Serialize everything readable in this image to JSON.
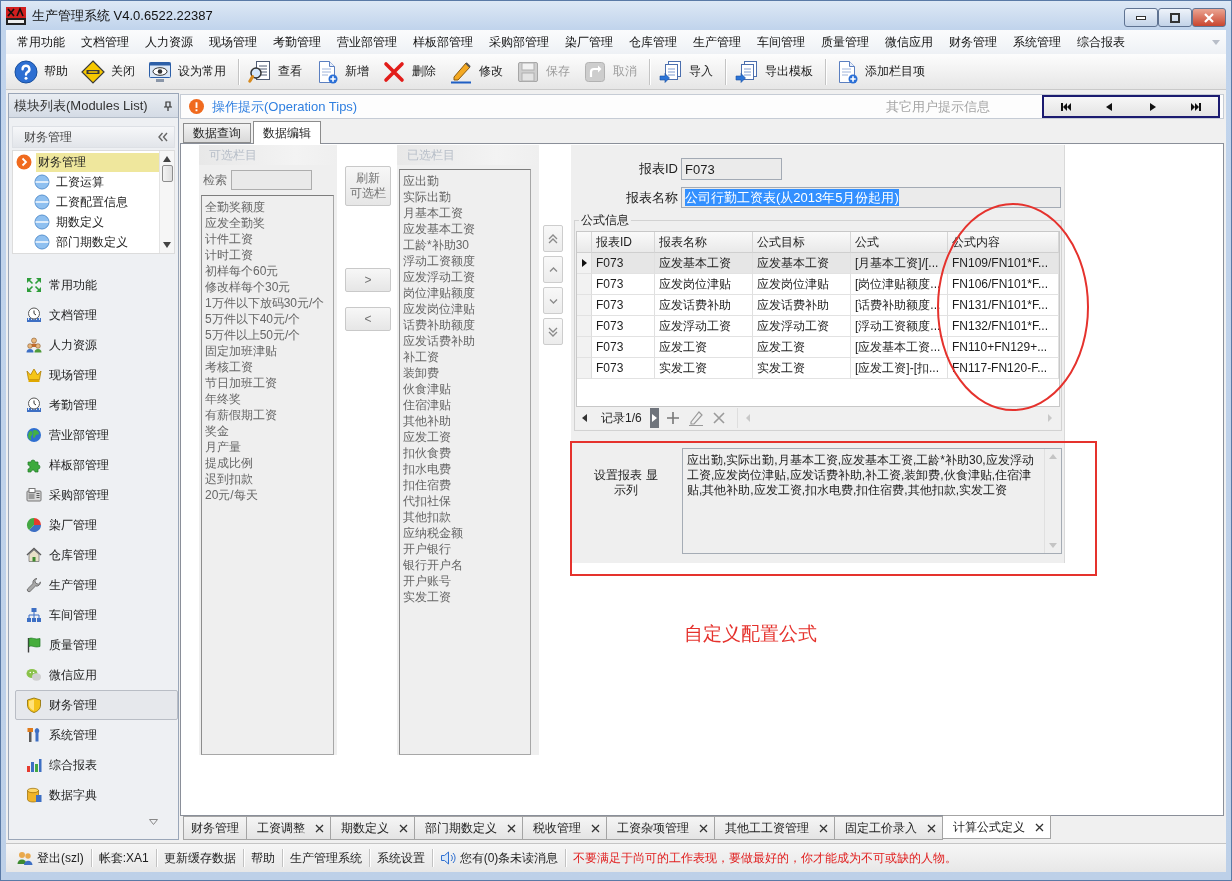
{
  "window": {
    "title": "生产管理系统 V4.0.6522.22387"
  },
  "menu": [
    "常用功能",
    "文档管理",
    "人力资源",
    "现场管理",
    "考勤管理",
    "营业部管理",
    "样板部管理",
    "采购部管理",
    "染厂管理",
    "仓库管理",
    "生产管理",
    "车间管理",
    "质量管理",
    "微信应用",
    "财务管理",
    "系统管理",
    "综合报表"
  ],
  "toolbar": [
    [
      {
        "label": "帮助",
        "kind": "help",
        "disabled": false
      },
      {
        "label": "关闭",
        "kind": "exit",
        "disabled": false
      },
      {
        "label": "设为常用",
        "kind": "favorite",
        "disabled": false
      }
    ],
    [
      {
        "label": "查看",
        "kind": "view",
        "disabled": false
      },
      {
        "label": "新增",
        "kind": "new",
        "disabled": false
      },
      {
        "label": "删除",
        "kind": "delete",
        "disabled": false
      },
      {
        "label": "修改",
        "kind": "edit",
        "disabled": false
      },
      {
        "label": "保存",
        "kind": "save",
        "disabled": true
      },
      {
        "label": "取消",
        "kind": "cancel",
        "disabled": true
      }
    ],
    [
      {
        "label": "导入",
        "kind": "import",
        "disabled": false
      }
    ],
    [
      {
        "label": "导出模板",
        "kind": "export",
        "disabled": false
      }
    ],
    [
      {
        "label": "添加栏目项",
        "kind": "addcolumn",
        "disabled": false
      }
    ]
  ],
  "modules": {
    "title": "模块列表(Modules List)",
    "group": {
      "title": "财务管理",
      "tree": [
        {
          "label": "财务管理",
          "selected": true,
          "children": [
            {
              "label": "工资运算",
              "selected": false
            },
            {
              "label": "工资配置信息",
              "selected": false
            },
            {
              "label": "期数定义",
              "selected": false
            },
            {
              "label": "部门期数定义",
              "selected": false
            }
          ]
        }
      ]
    },
    "nav": [
      {
        "label": "常用功能",
        "kind": "common",
        "selected": false
      },
      {
        "label": "文档管理",
        "kind": "document",
        "selected": false
      },
      {
        "label": "人力资源",
        "kind": "hr",
        "selected": false
      },
      {
        "label": "现场管理",
        "kind": "site",
        "selected": false
      },
      {
        "label": "考勤管理",
        "kind": "attendance",
        "selected": false
      },
      {
        "label": "营业部管理",
        "kind": "sales",
        "selected": false
      },
      {
        "label": "样板部管理",
        "kind": "sample",
        "selected": false
      },
      {
        "label": "采购部管理",
        "kind": "purchase",
        "selected": false
      },
      {
        "label": "染厂管理",
        "kind": "dye",
        "selected": false
      },
      {
        "label": "仓库管理",
        "kind": "warehouse",
        "selected": false
      },
      {
        "label": "生产管理",
        "kind": "production",
        "selected": false
      },
      {
        "label": "车间管理",
        "kind": "workshop",
        "selected": false
      },
      {
        "label": "质量管理",
        "kind": "quality",
        "selected": false
      },
      {
        "label": "微信应用",
        "kind": "wechat",
        "selected": false
      },
      {
        "label": "财务管理",
        "kind": "finance",
        "selected": true
      },
      {
        "label": "系统管理",
        "kind": "system",
        "selected": false
      },
      {
        "label": "综合报表",
        "kind": "report",
        "selected": false
      },
      {
        "label": "数据字典",
        "kind": "dictionary",
        "selected": false
      }
    ]
  },
  "tips": {
    "title": "操作提示(Operation Tips)",
    "other": "其它用户提示信息",
    "nav": [
      {
        "kind": "first"
      },
      {
        "kind": "prev"
      },
      {
        "kind": "next"
      },
      {
        "kind": "last"
      }
    ]
  },
  "tabs": [
    {
      "label": "数据查询",
      "selected": false
    },
    {
      "label": "数据编辑",
      "selected": true
    }
  ],
  "available_columns": {
    "title": "可选栏目",
    "disabled": true,
    "search_label": "检索",
    "items": [
      "全勤奖额度",
      "应发全勤奖",
      "计件工资",
      "计时工资",
      "初样每个60元",
      "修改样每个30元",
      "1万件以下放码30元/个",
      "5万件以下40元/个",
      "5万件以上50元/个",
      "固定加班津贴",
      "考核工资",
      "节日加班工资",
      "年终奖",
      "有薪假期工资",
      "奖金",
      "月产量",
      "提成比例",
      "迟到扣款",
      "20元/每天"
    ]
  },
  "refresh_button": "刷新可选栏",
  "transfer_buttons": [
    ">",
    "<"
  ],
  "selected_columns": {
    "title": "已选栏目",
    "disabled": true,
    "items": [
      "应出勤",
      "实际出勤",
      "月基本工资",
      "应发基本工资",
      "工龄*补助30",
      "浮动工资额度",
      "应发浮动工资",
      "岗位津贴额度",
      "应发岗位津贴",
      "话费补助额度",
      "应发话费补助",
      "补工资",
      "装卸费",
      "伙食津贴",
      "住宿津贴",
      "其他补助",
      "应发工资",
      "扣伙食费",
      "扣水电费",
      "扣住宿费",
      "代扣社保",
      "其他扣款",
      "应纳税金额",
      "开户银行",
      "银行开户名",
      "开户账号",
      "实发工资"
    ]
  },
  "move_buttons": [
    {
      "kind": "top"
    },
    {
      "kind": "up"
    },
    {
      "kind": "down"
    },
    {
      "kind": "bottom"
    }
  ],
  "report": {
    "id_label": "报表ID",
    "id_value": "F073",
    "name_label": "报表名称",
    "name_value": "公司行勤工资表(从2013年5月份起用)",
    "name_text_selected": true
  },
  "formula_info": {
    "title": "公式信息",
    "columns": [
      "报表ID",
      "报表名称",
      "公式目标",
      "公式",
      "公式内容"
    ],
    "rows": [
      {
        "selected": true,
        "cells": [
          "F073",
          "应发基本工资",
          "应发基本工资",
          "[月基本工资]/[...",
          "FN109/FN101*F..."
        ]
      },
      {
        "selected": false,
        "cells": [
          "F073",
          "应发岗位津贴",
          "应发岗位津贴",
          "[岗位津贴额度...",
          "FN106/FN101*F..."
        ]
      },
      {
        "selected": false,
        "cells": [
          "F073",
          "应发话费补助",
          "应发话费补助",
          "[话费补助额度...",
          "FN131/FN101*F..."
        ]
      },
      {
        "selected": false,
        "cells": [
          "F073",
          "应发浮动工资",
          "应发浮动工资",
          "[浮动工资额度...",
          "FN132/FN101*F..."
        ]
      },
      {
        "selected": false,
        "cells": [
          "F073",
          "应发工资",
          "应发工资",
          "[应发基本工资...",
          "FN110+FN129+..."
        ]
      },
      {
        "selected": false,
        "cells": [
          "F073",
          "实发工资",
          "实发工资",
          "[应发工资]-[扣...",
          "FN117-FN120-F..."
        ]
      }
    ],
    "record": "记录1/6"
  },
  "display_columns": {
    "label": "设置报表 显示列",
    "value": "应出勤,实际出勤,月基本工资,应发基本工资,工龄*补助30,应发浮动工资,应发岗位津贴,应发话费补助,补工资,装卸费,伙食津贴,住宿津贴,其他补助,应发工资,扣水电费,扣住宿费,其他扣款,实发工资"
  },
  "annotation": {
    "caption": "自定义配置公式"
  },
  "doc_tabs": [
    {
      "label": "财务管理",
      "closable": false,
      "selected": false
    },
    {
      "label": "工资调整",
      "closable": true,
      "selected": false
    },
    {
      "label": "期数定义",
      "closable": true,
      "selected": false
    },
    {
      "label": "部门期数定义",
      "closable": true,
      "selected": false
    },
    {
      "label": "税收管理",
      "closable": true,
      "selected": false
    },
    {
      "label": "工资杂项管理",
      "closable": true,
      "selected": false
    },
    {
      "label": "其他工工资管理",
      "closable": true,
      "selected": false
    },
    {
      "label": "固定工价录入",
      "closable": true,
      "selected": false
    },
    {
      "label": "计算公式定义",
      "closable": true,
      "selected": true
    }
  ],
  "status_bar": [
    {
      "kind": "user",
      "label": "登出(szl)"
    },
    {
      "kind": "text",
      "label": "帐套:XA1"
    },
    {
      "kind": "link",
      "label": "更新缓存数据"
    },
    {
      "kind": "link",
      "label": "帮助"
    },
    {
      "kind": "link",
      "label": "生产管理系统"
    },
    {
      "kind": "link",
      "label": "系统设置"
    },
    {
      "kind": "message",
      "label": "您有(0)条未读消息"
    },
    {
      "kind": "notice",
      "label": "不要满足于尚可的工作表现，要做最好的，你才能成为不可或缺的人物。"
    }
  ]
}
